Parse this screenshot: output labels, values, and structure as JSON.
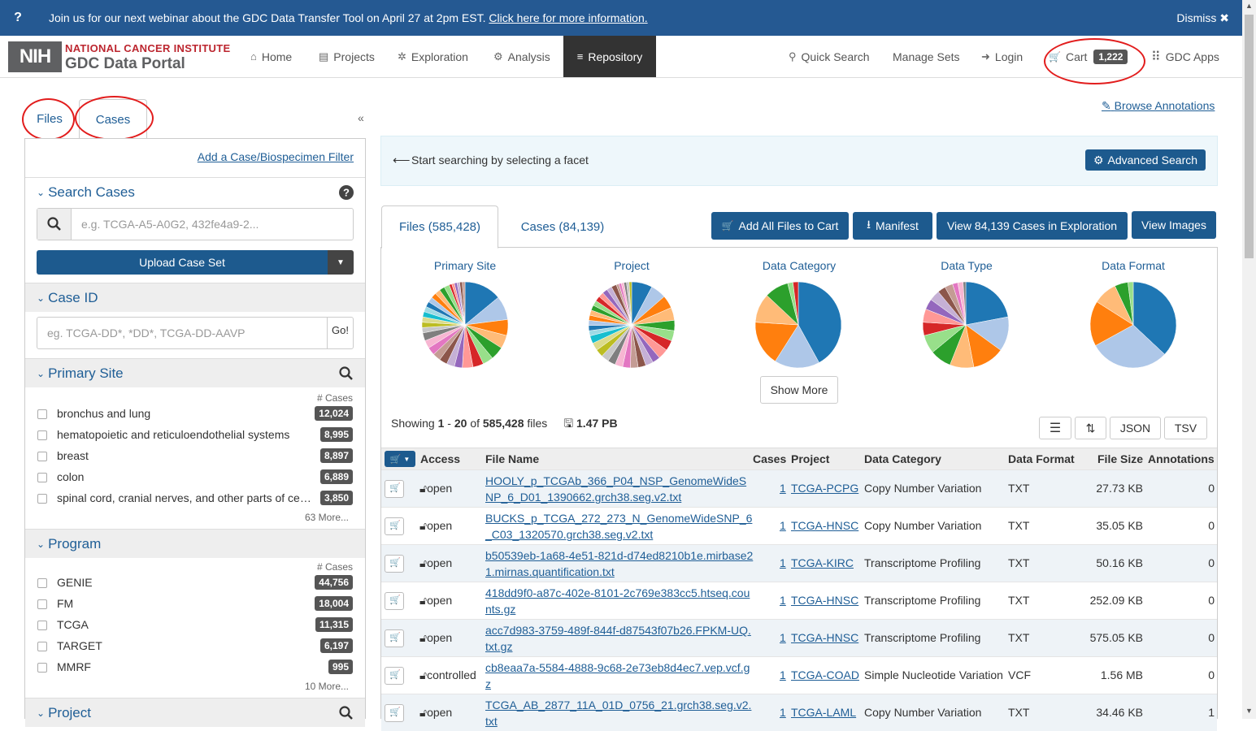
{
  "banner": {
    "message": "Join us for our next webinar about the GDC Data Transfer Tool on April 27 at 2pm EST.",
    "link": "Click here for more information.",
    "dismiss": "Dismiss ✖",
    "icon": "?"
  },
  "header": {
    "logo_nih": "NIH",
    "logo_line1": "NATIONAL CANCER INSTITUTE",
    "logo_line2": "GDC Data Portal",
    "nav": [
      {
        "label": "Home",
        "icon": "home-icon",
        "glyph": "⌂"
      },
      {
        "label": "Projects",
        "icon": "projects-icon",
        "glyph": "▤"
      },
      {
        "label": "Exploration",
        "icon": "exploration-icon",
        "glyph": "✲"
      },
      {
        "label": "Analysis",
        "icon": "analysis-icon",
        "glyph": "⚙"
      },
      {
        "label": "Repository",
        "icon": "database-icon",
        "glyph": "≡"
      }
    ],
    "right": [
      {
        "label": "Quick Search",
        "icon": "search-icon",
        "glyph": "⚲"
      },
      {
        "label": "Manage Sets",
        "icon": "",
        "glyph": ""
      },
      {
        "label": "Login",
        "icon": "login-icon",
        "glyph": "➜"
      },
      {
        "label": "Cart",
        "icon": "cart-icon",
        "glyph": "🛒"
      },
      {
        "label": "GDC Apps",
        "icon": "apps-grid-icon",
        "glyph": "⁞⁞"
      }
    ],
    "cart_count": "1,222"
  },
  "sidebar": {
    "tabs": [
      "Files",
      "Cases"
    ],
    "collapse": "«",
    "add_filter": "Add a Case/Biospecimen Filter",
    "search_cases": {
      "title": "Search Cases",
      "placeholder": "e.g. TCGA-A5-A0G2, 432fe4a9-2...",
      "upload": "Upload Case Set"
    },
    "case_id": {
      "title": "Case ID",
      "placeholder": "eg. TCGA-DD*, *DD*, TCGA-DD-AAVP",
      "go": "Go!"
    },
    "primary_site": {
      "title": "Primary Site",
      "col": "# Cases",
      "items": [
        {
          "label": "bronchus and lung",
          "count": "12,024"
        },
        {
          "label": "hematopoietic and reticuloendothelial systems",
          "count": "8,995"
        },
        {
          "label": "breast",
          "count": "8,897"
        },
        {
          "label": "colon",
          "count": "6,889"
        },
        {
          "label": "spinal cord, cranial nerves, and other parts of ce…",
          "count": "3,850"
        }
      ],
      "more": "63 More..."
    },
    "program": {
      "title": "Program",
      "col": "# Cases",
      "items": [
        {
          "label": "GENIE",
          "count": "44,756"
        },
        {
          "label": "FM",
          "count": "18,004"
        },
        {
          "label": "TCGA",
          "count": "11,315"
        },
        {
          "label": "TARGET",
          "count": "6,197"
        },
        {
          "label": "MMRF",
          "count": "995"
        }
      ],
      "more": "10 More..."
    },
    "project": {
      "title": "Project"
    }
  },
  "main": {
    "browse_annotations": "Browse Annotations",
    "start_msg": "Start searching by selecting a facet",
    "advanced_search": "Advanced Search",
    "tabs": [
      "Files (585,428)",
      "Cases (84,139)"
    ],
    "buttons": {
      "add_all": "Add All Files to Cart",
      "manifest": "Manifest",
      "view_cases": "View 84,139 Cases in Exploration",
      "view_images": "View Images"
    },
    "pie_titles": [
      "Primary Site",
      "Project",
      "Data Category",
      "Data Type",
      "Data Format"
    ],
    "show_more": "Show More",
    "showing": {
      "prefix": "Showing",
      "from": "1",
      "dash": "-",
      "to": "20",
      "of": "of",
      "total": "585,428",
      "suffix": "files",
      "size": "1.47 PB"
    },
    "export": [
      "JSON",
      "TSV"
    ],
    "columns": [
      "Access",
      "File Name",
      "Cases",
      "Project",
      "Data Category",
      "Data Format",
      "File Size",
      "Annotations"
    ],
    "rows": [
      {
        "access": "open",
        "file": "HOOLY_p_TCGAb_366_P04_NSP_GenomeWideSNP_6_D01_1390662.grch38.seg.v2.txt",
        "cases": "1",
        "project": "TCGA-PCPG",
        "category": "Copy Number Variation",
        "format": "TXT",
        "size": "27.73 KB",
        "ann": "0"
      },
      {
        "access": "open",
        "file": "BUCKS_p_TCGA_272_273_N_GenomeWideSNP_6_C03_1320570.grch38.seg.v2.txt",
        "cases": "1",
        "project": "TCGA-HNSC",
        "category": "Copy Number Variation",
        "format": "TXT",
        "size": "35.05 KB",
        "ann": "0"
      },
      {
        "access": "open",
        "file": "b50539eb-1a68-4e51-821d-d74ed8210b1e.mirbase21.mirnas.quantification.txt",
        "cases": "1",
        "project": "TCGA-KIRC",
        "category": "Transcriptome Profiling",
        "format": "TXT",
        "size": "50.16 KB",
        "ann": "0"
      },
      {
        "access": "open",
        "file": "418dd9f0-a87c-402e-8101-2c769e383cc5.htseq.counts.gz",
        "cases": "1",
        "project": "TCGA-HNSC",
        "category": "Transcriptome Profiling",
        "format": "TXT",
        "size": "252.09 KB",
        "ann": "0"
      },
      {
        "access": "open",
        "file": "acc7d983-3759-489f-844f-d87543f07b26.FPKM-UQ.txt.gz",
        "cases": "1",
        "project": "TCGA-HNSC",
        "category": "Transcriptome Profiling",
        "format": "TXT",
        "size": "575.05 KB",
        "ann": "0"
      },
      {
        "access": "controlled",
        "file": "cb8eaa7a-5584-4888-9c68-2e73eb8d4ec7.vep.vcf.gz",
        "cases": "1",
        "project": "TCGA-COAD",
        "category": "Simple Nucleotide Variation",
        "format": "VCF",
        "size": "1.56 MB",
        "ann": "0"
      },
      {
        "access": "open",
        "file": "TCGA_AB_2877_11A_01D_0756_21.grch38.seg.v2.txt",
        "cases": "1",
        "project": "TCGA-LAML",
        "category": "Copy Number Variation",
        "format": "TXT",
        "size": "34.46 KB",
        "ann": "1"
      }
    ]
  },
  "pie_colors": [
    "#1f77b4",
    "#aec7e8",
    "#ff7f0e",
    "#ffbb78",
    "#2ca02c",
    "#98df8a",
    "#d62728",
    "#ff9896",
    "#9467bd",
    "#c5b0d5",
    "#8c564b",
    "#c49c94",
    "#e377c2",
    "#f7b6d2",
    "#7f7f7f",
    "#c7c7c7",
    "#bcbd22",
    "#dbdb8d",
    "#17becf",
    "#9edae5"
  ]
}
